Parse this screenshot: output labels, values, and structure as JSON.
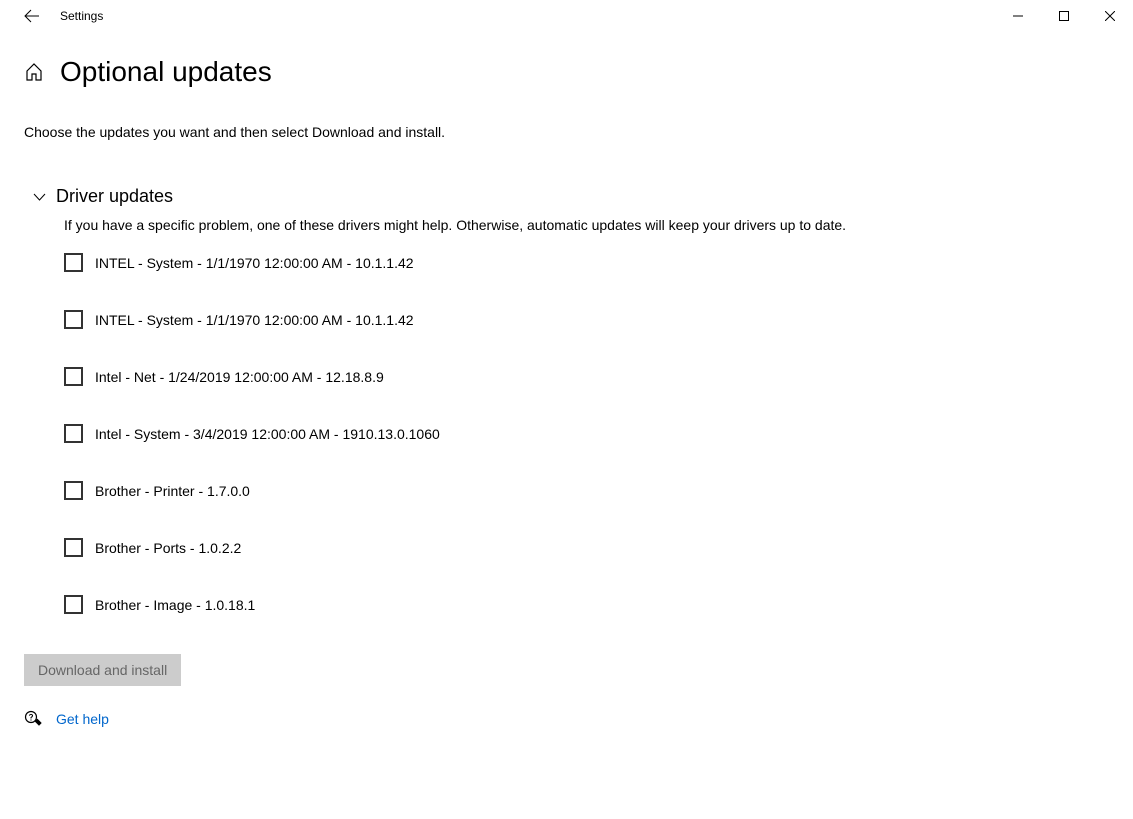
{
  "app_title": "Settings",
  "page_title": "Optional updates",
  "subtitle": "Choose the updates you want and then select Download and install.",
  "section": {
    "title": "Driver updates",
    "description": "If you have a specific problem, one of these drivers might help. Otherwise, automatic updates will keep your drivers up to date.",
    "items": [
      {
        "label": "INTEL - System - 1/1/1970 12:00:00 AM - 10.1.1.42",
        "checked": false
      },
      {
        "label": "INTEL - System - 1/1/1970 12:00:00 AM - 10.1.1.42",
        "checked": false
      },
      {
        "label": "Intel - Net - 1/24/2019 12:00:00 AM - 12.18.8.9",
        "checked": false
      },
      {
        "label": "Intel - System - 3/4/2019 12:00:00 AM - 1910.13.0.1060",
        "checked": false
      },
      {
        "label": "Brother - Printer - 1.7.0.0",
        "checked": false
      },
      {
        "label": "Brother - Ports - 1.0.2.2",
        "checked": false
      },
      {
        "label": "Brother - Image - 1.0.18.1",
        "checked": false
      }
    ]
  },
  "install_button": "Download and install",
  "help_link": "Get help"
}
